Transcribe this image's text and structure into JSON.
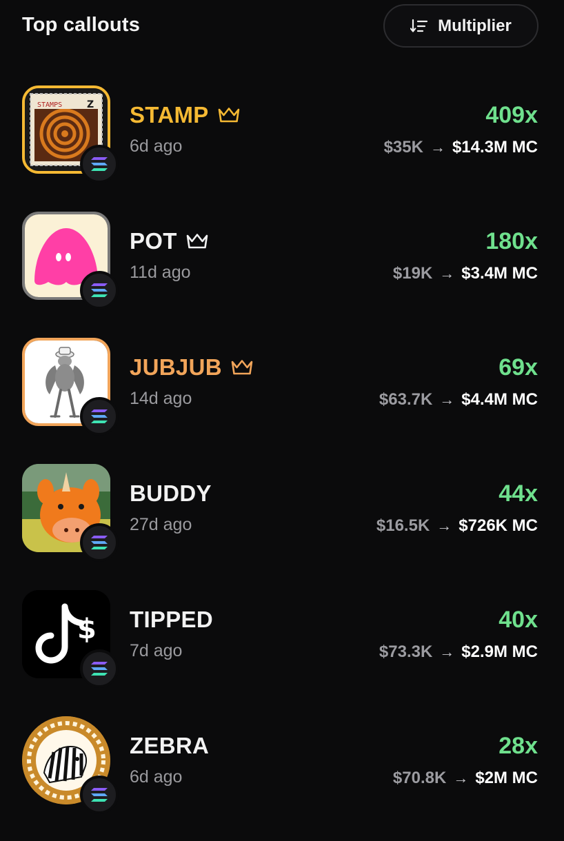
{
  "header": {
    "title": "Top callouts",
    "sort_label": "Multiplier",
    "sort_icon": "sort-descending-icon"
  },
  "colors": {
    "gold": "#f5b933",
    "orange": "#f2a55a",
    "white": "#ffffff",
    "green": "#6fe08d",
    "muted": "#9a9a9e"
  },
  "callouts": [
    {
      "symbol": "STAMP",
      "age": "6d ago",
      "multiplier": "409x",
      "mc_from": "$35K",
      "arrow": "→",
      "mc_to": "$14.3M MC",
      "crown": true,
      "accent": "#f5b933"
    },
    {
      "symbol": "POT",
      "age": "11d ago",
      "multiplier": "180x",
      "mc_from": "$19K",
      "arrow": "→",
      "mc_to": "$3.4M MC",
      "crown": true,
      "accent": "#ffffff"
    },
    {
      "symbol": "JUBJUB",
      "age": "14d ago",
      "multiplier": "69x",
      "mc_from": "$63.7K",
      "arrow": "→",
      "mc_to": "$4.4M MC",
      "crown": true,
      "accent": "#f2a55a"
    },
    {
      "symbol": "BUDDY",
      "age": "27d ago",
      "multiplier": "44x",
      "mc_from": "$16.5K",
      "arrow": "→",
      "mc_to": "$726K MC",
      "crown": false,
      "accent": "#ffffff"
    },
    {
      "symbol": "TIPPED",
      "age": "7d ago",
      "multiplier": "40x",
      "mc_from": "$73.3K",
      "arrow": "→",
      "mc_to": "$2.9M MC",
      "crown": false,
      "accent": "#ffffff"
    },
    {
      "symbol": "ZEBRA",
      "age": "6d ago",
      "multiplier": "28x",
      "mc_from": "$70.8K",
      "arrow": "→",
      "mc_to": "$2M MC",
      "crown": false,
      "accent": "#ffffff"
    }
  ]
}
